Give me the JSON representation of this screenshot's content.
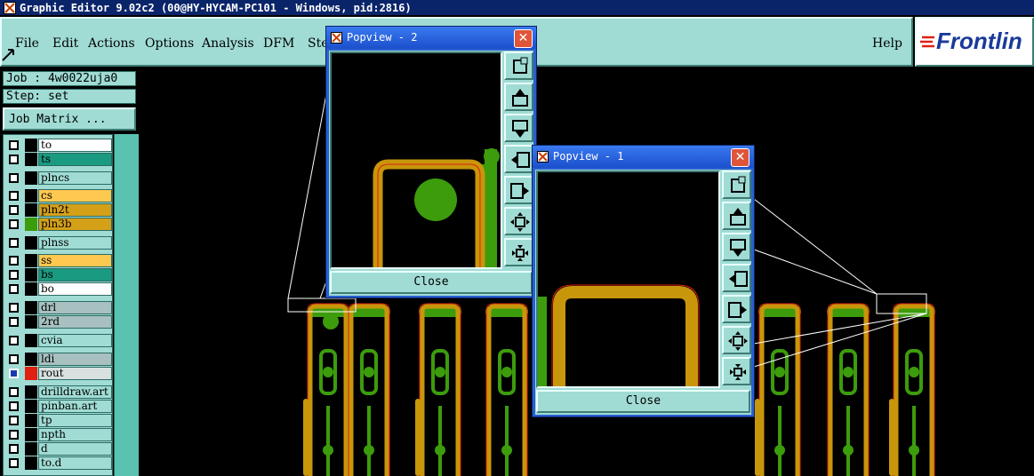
{
  "window": {
    "title": "Graphic Editor 9.02c2 (00@HY-HYCAM-PC101 - Windows, pid:2816)"
  },
  "menu": {
    "items": [
      {
        "label": "File"
      },
      {
        "label": "Edit"
      },
      {
        "label": "Actions"
      },
      {
        "label": "Options"
      },
      {
        "label": "Analysis"
      },
      {
        "label": "DFM"
      },
      {
        "label": "Ste"
      }
    ],
    "help": "Help"
  },
  "logo": {
    "text": "Frontlin"
  },
  "job": {
    "job_line": "Job : 4w0022uja0",
    "step_line": "Step: set",
    "matrix_button": "Job Matrix ..."
  },
  "layers": [
    {
      "name": "to",
      "color": "#ffffff"
    },
    {
      "name": "ts",
      "color": "#1a9a80"
    },
    {
      "name": "plncs",
      "color": "#a0dcd4"
    },
    {
      "name": "cs",
      "color": "#ffc850"
    },
    {
      "name": "pln2t",
      "color": "#d4a018"
    },
    {
      "name": "pln3b",
      "color": "#d4a018"
    },
    {
      "name": "plnss",
      "color": "#a0dcd4"
    },
    {
      "name": "ss",
      "color": "#ffc850"
    },
    {
      "name": "bs",
      "color": "#1a9a80"
    },
    {
      "name": "bo",
      "color": "#ffffff"
    },
    {
      "name": "drl",
      "color": "#a8c0c0"
    },
    {
      "name": "2rd",
      "color": "#a8c0c0"
    },
    {
      "name": "cvia",
      "color": "#a0dcd4"
    },
    {
      "name": "ldi",
      "color": "#a8c0c0"
    },
    {
      "name": "rout",
      "color": "#d8e0e0"
    },
    {
      "name": "drilldraw.art",
      "color": "#a0dcd4"
    },
    {
      "name": "pinban.art",
      "color": "#a0dcd4"
    },
    {
      "name": "tp",
      "color": "#a0dcd4"
    },
    {
      "name": "npth",
      "color": "#a0dcd4"
    },
    {
      "name": "d",
      "color": "#a0dcd4"
    },
    {
      "name": "to.d",
      "color": "#a0dcd4"
    }
  ],
  "popview2": {
    "title": "Popview - 2",
    "close_label": "Close",
    "close_glyph": "✕"
  },
  "popview1": {
    "title": "Popview - 1",
    "close_label": "Close",
    "close_glyph": "✕"
  },
  "colors": {
    "panel": "#a0dcd4",
    "copper_orange": "#c8960a",
    "copper_green": "#3c9c0c",
    "outline_red": "#e02010",
    "titlebar": "#0a246a"
  },
  "icons": {
    "tools": [
      "zoom-fit-icon",
      "pan-up-icon",
      "pan-down-icon",
      "pan-left-icon",
      "pan-right-icon",
      "zoom-in-icon",
      "zoom-out-icon"
    ]
  }
}
